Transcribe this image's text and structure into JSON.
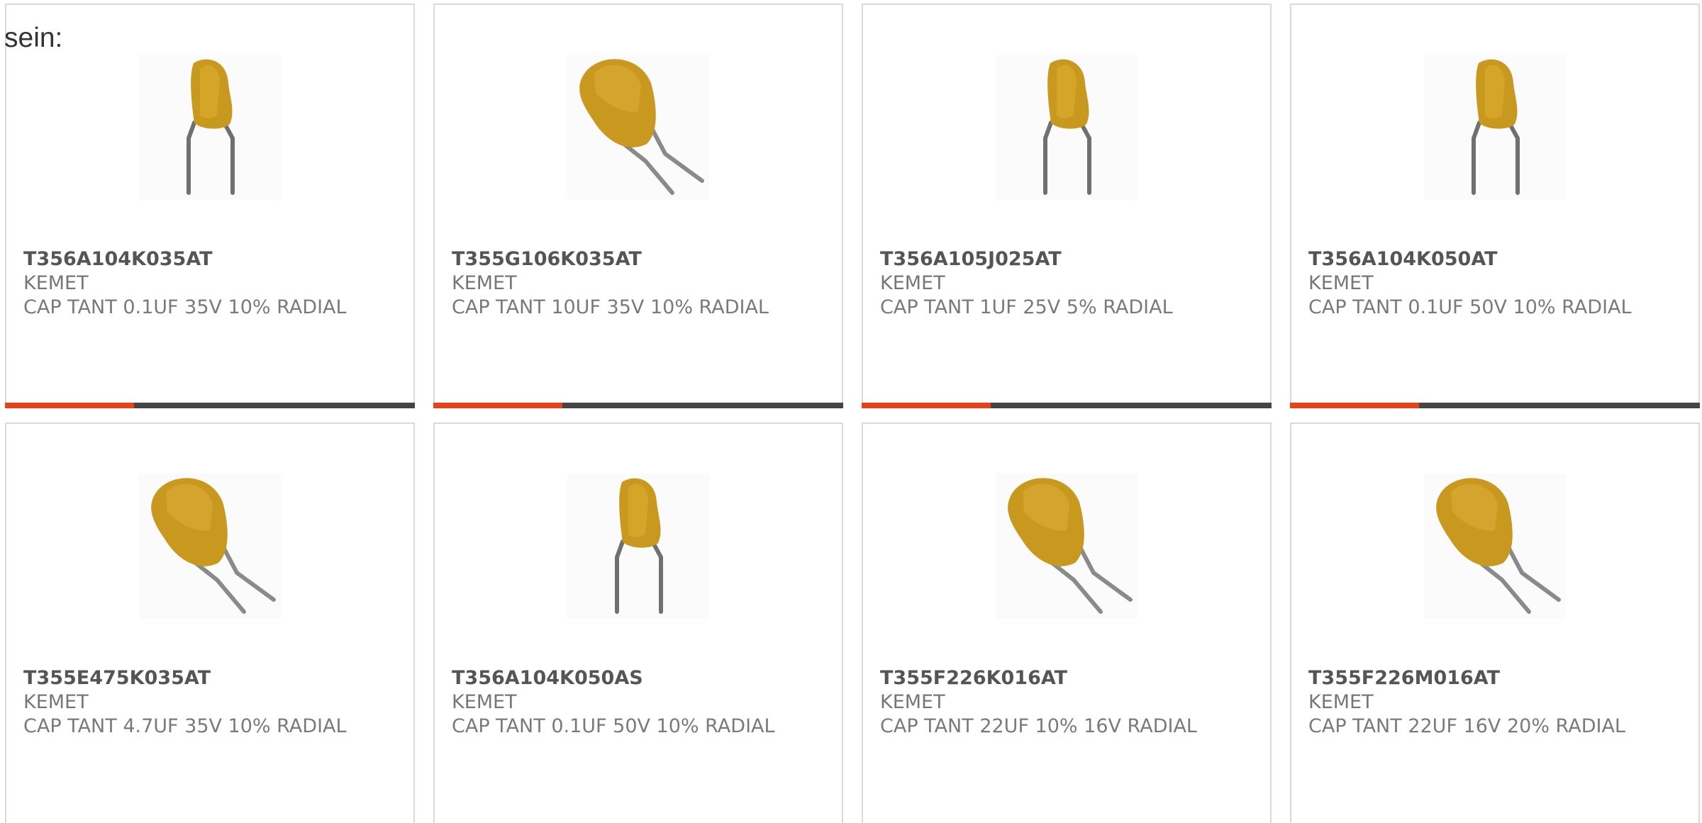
{
  "lead_text": "sein:",
  "accent_color": "#e8421c",
  "bar_color": "#444444",
  "products": [
    {
      "part_number": "T356A104K035AT",
      "manufacturer": "KEMET",
      "description": "CAP TANT 0.1UF 35V 10% RADIAL",
      "image_icon": "capacitor-upright-icon"
    },
    {
      "part_number": "T355G106K035AT",
      "manufacturer": "KEMET",
      "description": "CAP TANT 10UF 35V 10% RADIAL",
      "image_icon": "capacitor-bulb-icon"
    },
    {
      "part_number": "T356A105J025AT",
      "manufacturer": "KEMET",
      "description": "CAP TANT 1UF 25V 5% RADIAL",
      "image_icon": "capacitor-upright-icon"
    },
    {
      "part_number": "T356A104K050AT",
      "manufacturer": "KEMET",
      "description": "CAP TANT 0.1UF 50V 10% RADIAL",
      "image_icon": "capacitor-upright-icon"
    },
    {
      "part_number": "T355E475K035AT",
      "manufacturer": "KEMET",
      "description": "CAP TANT 4.7UF 35V 10% RADIAL",
      "image_icon": "capacitor-bulb-icon"
    },
    {
      "part_number": "T356A104K050AS",
      "manufacturer": "KEMET",
      "description": "CAP TANT 0.1UF 50V 10% RADIAL",
      "image_icon": "capacitor-upright-icon"
    },
    {
      "part_number": "T355F226K016AT",
      "manufacturer": "KEMET",
      "description": "CAP TANT 22UF 10% 16V RADIAL",
      "image_icon": "capacitor-bulb-icon"
    },
    {
      "part_number": "T355F226M016AT",
      "manufacturer": "KEMET",
      "description": "CAP TANT 22UF 16V 20% RADIAL",
      "image_icon": "capacitor-bulb-icon"
    }
  ]
}
